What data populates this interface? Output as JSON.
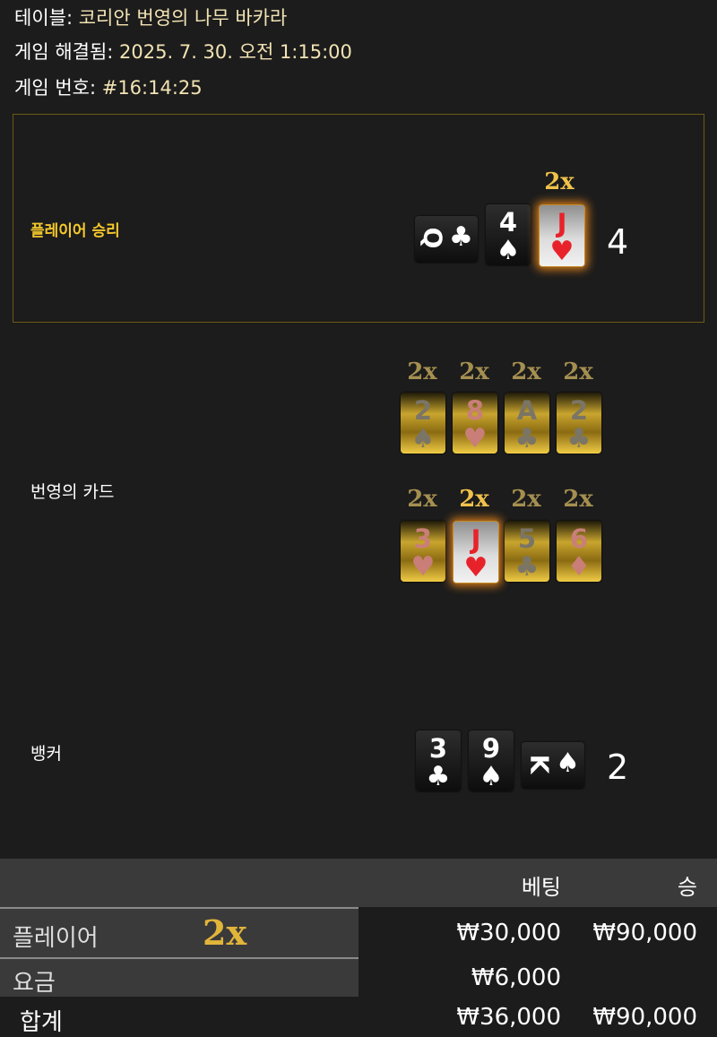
{
  "header": {
    "table_label": "테이블:",
    "table_value": "코리안 번영의 나무 바카라",
    "resolved_label": "게임 해결됨:",
    "resolved_value": "2025. 7. 30. 오전 1:15:00",
    "game_no_label": "게임 번호:",
    "game_no_value": "#16:14:25"
  },
  "player": {
    "label": "플레이어 승리",
    "multiplier": "2x",
    "score": "4",
    "cards": [
      {
        "rank": "Q",
        "suit": "♣",
        "color": "black",
        "sideways": true
      },
      {
        "rank": "4",
        "suit": "♠",
        "color": "black"
      },
      {
        "rank": "J",
        "suit": "♥",
        "color": "red",
        "highlight": true
      }
    ]
  },
  "prosperity": {
    "label": "번영의 카드",
    "row1": [
      {
        "mult": "2x",
        "rank": "2",
        "suit": "♠"
      },
      {
        "mult": "2x",
        "rank": "8",
        "suit": "♥"
      },
      {
        "mult": "2x",
        "rank": "A",
        "suit": "♣"
      },
      {
        "mult": "2x",
        "rank": "2",
        "suit": "♣"
      }
    ],
    "row2": [
      {
        "mult": "2x",
        "rank": "3",
        "suit": "♥"
      },
      {
        "mult": "2x",
        "rank": "J",
        "suit": "♥"
      },
      {
        "mult": "2x",
        "rank": "5",
        "suit": "♣"
      },
      {
        "mult": "2x",
        "rank": "6",
        "suit": "♦"
      }
    ]
  },
  "banker": {
    "label": "뱅커",
    "score": "2",
    "cards": [
      {
        "rank": "3",
        "suit": "♣"
      },
      {
        "rank": "9",
        "suit": "♠"
      },
      {
        "rank": "K",
        "suit": "♠",
        "sideways": true
      }
    ]
  },
  "table": {
    "col_bet": "베팅",
    "col_win": "승",
    "rows": [
      {
        "name": "플레이어",
        "mult": "2x",
        "bet": "₩30,000",
        "win": "₩90,000"
      },
      {
        "name": "요금",
        "bet": "₩6,000",
        "win": ""
      },
      {
        "name": "합계",
        "bet": "₩36,000",
        "win": "₩90,000"
      }
    ]
  },
  "colors": {
    "accent": "#f4c82c",
    "card_red": "#e8222a",
    "win_border": "#6b5a16"
  }
}
